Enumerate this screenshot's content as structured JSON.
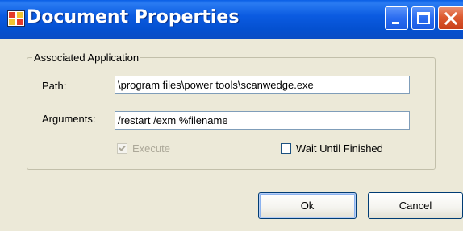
{
  "window": {
    "title": "Document Properties",
    "colors": {
      "titlebar": "#0a57d8",
      "close_button": "#d9512a",
      "dialog_background": "#ece9d8"
    }
  },
  "titlebar_buttons": {
    "minimize_icon": "minimize-icon",
    "maximize_icon": "maximize-icon",
    "close_icon": "close-icon"
  },
  "group": {
    "legend": "Associated Application"
  },
  "path": {
    "label": "Path:",
    "value": "\\program files\\power tools\\scanwedge.exe"
  },
  "arguments": {
    "label": "Arguments:",
    "value": "/restart /exm %filename"
  },
  "execute": {
    "label": "Execute",
    "checked": true,
    "enabled": false
  },
  "wait_until_finished": {
    "label": "Wait Until Finished",
    "checked": false
  },
  "buttons": {
    "ok": "Ok",
    "cancel": "Cancel"
  }
}
